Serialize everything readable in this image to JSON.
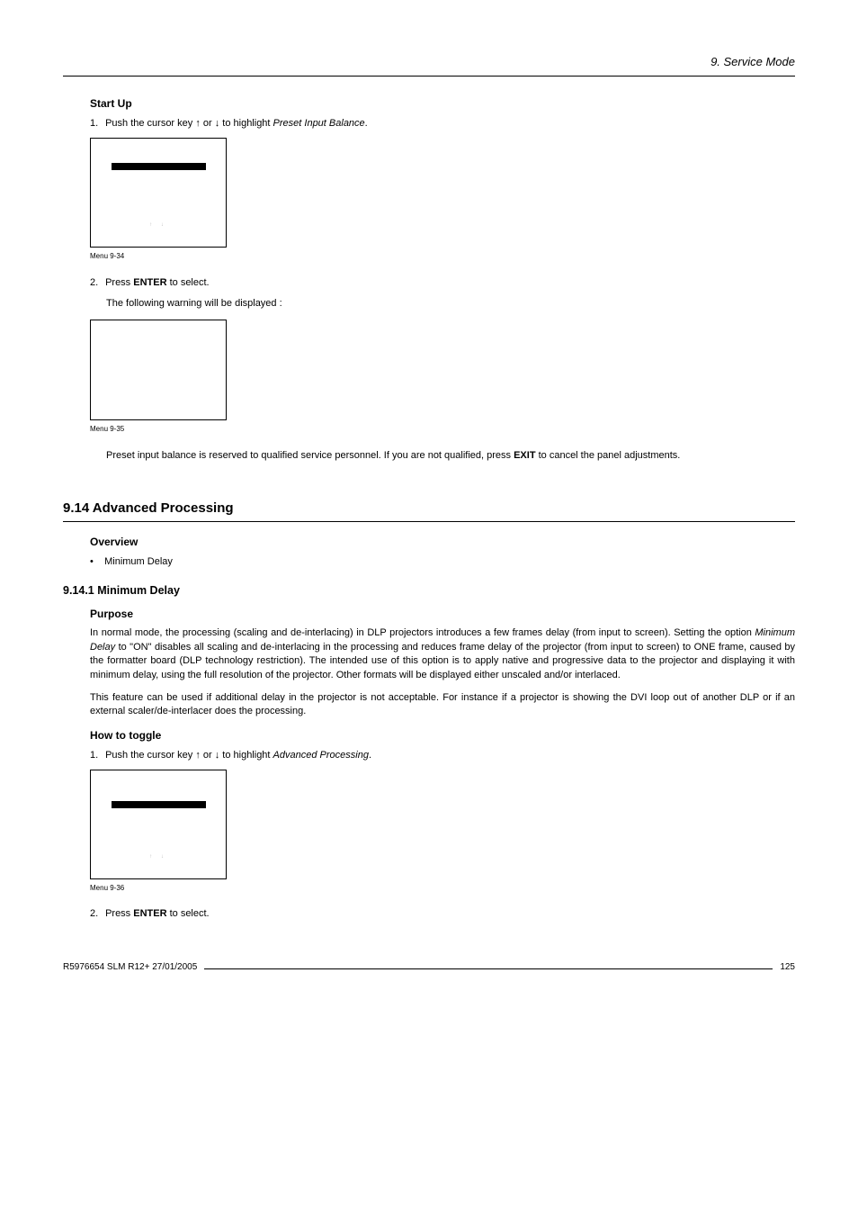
{
  "header": {
    "breadcrumb": "9. Service Mode"
  },
  "startup": {
    "heading": "Start Up",
    "step1_num": "1.",
    "step1_text_a": "Push the cursor key ↑ or ↓ to highlight ",
    "step1_text_em": "Preset Input Balance",
    "step1_text_b": ".",
    "menu34": {
      "arrows": "↑   ↓"
    },
    "menu34_label": "Menu 9-34",
    "step2_num": "2.",
    "step2_text_a": "Press ",
    "step2_text_strong": "ENTER",
    "step2_text_b": " to select.",
    "step2_sub": "The following warning will be displayed :",
    "menu35_label": "Menu 9-35",
    "note_a": "Preset input balance is reserved to qualified service personnel. If you are not qualified, press ",
    "note_strong": "EXIT",
    "note_b": " to cancel the panel adjustments."
  },
  "advanced": {
    "heading": "9.14 Advanced Processing",
    "overview_heading": "Overview",
    "bullet_prefix": "•",
    "bullet1": "Minimum Delay",
    "sub_num_heading": "9.14.1  Minimum Delay",
    "purpose_heading": "Purpose",
    "purpose_p1_a": "In normal mode, the processing (scaling and de-interlacing) in DLP projectors introduces a few frames delay (from input to screen). Setting the option ",
    "purpose_p1_em": "Minimum Delay",
    "purpose_p1_b": " to \"ON\" disables all scaling and de-interlacing in the processing and reduces frame delay of the projector (from input to screen) to ONE frame, caused by the formatter board (DLP technology restriction). The intended use of this option is to apply native and progressive data to the projector and displaying it with minimum delay, using the full resolution of the projector. Other formats will be displayed either unscaled and/or interlaced.",
    "purpose_p2": "This feature can be used if additional delay in the projector is not acceptable. For instance if a projector is showing the DVI loop out of another DLP or if an external scaler/de-interlacer does the processing.",
    "toggle_heading": "How to toggle",
    "toggle_step1_num": "1.",
    "toggle_step1_a": "Push the cursor key ↑ or ↓ to highlight ",
    "toggle_step1_em": "Advanced Processing",
    "toggle_step1_b": ".",
    "menu36": {
      "arrows": "↑   ↓"
    },
    "menu36_label": "Menu 9-36",
    "toggle_step2_num": "2.",
    "toggle_step2_a": "Press ",
    "toggle_step2_strong": "ENTER",
    "toggle_step2_b": " to select."
  },
  "footer": {
    "left": "R5976654 SLM R12+ 27/01/2005",
    "right": "125"
  }
}
